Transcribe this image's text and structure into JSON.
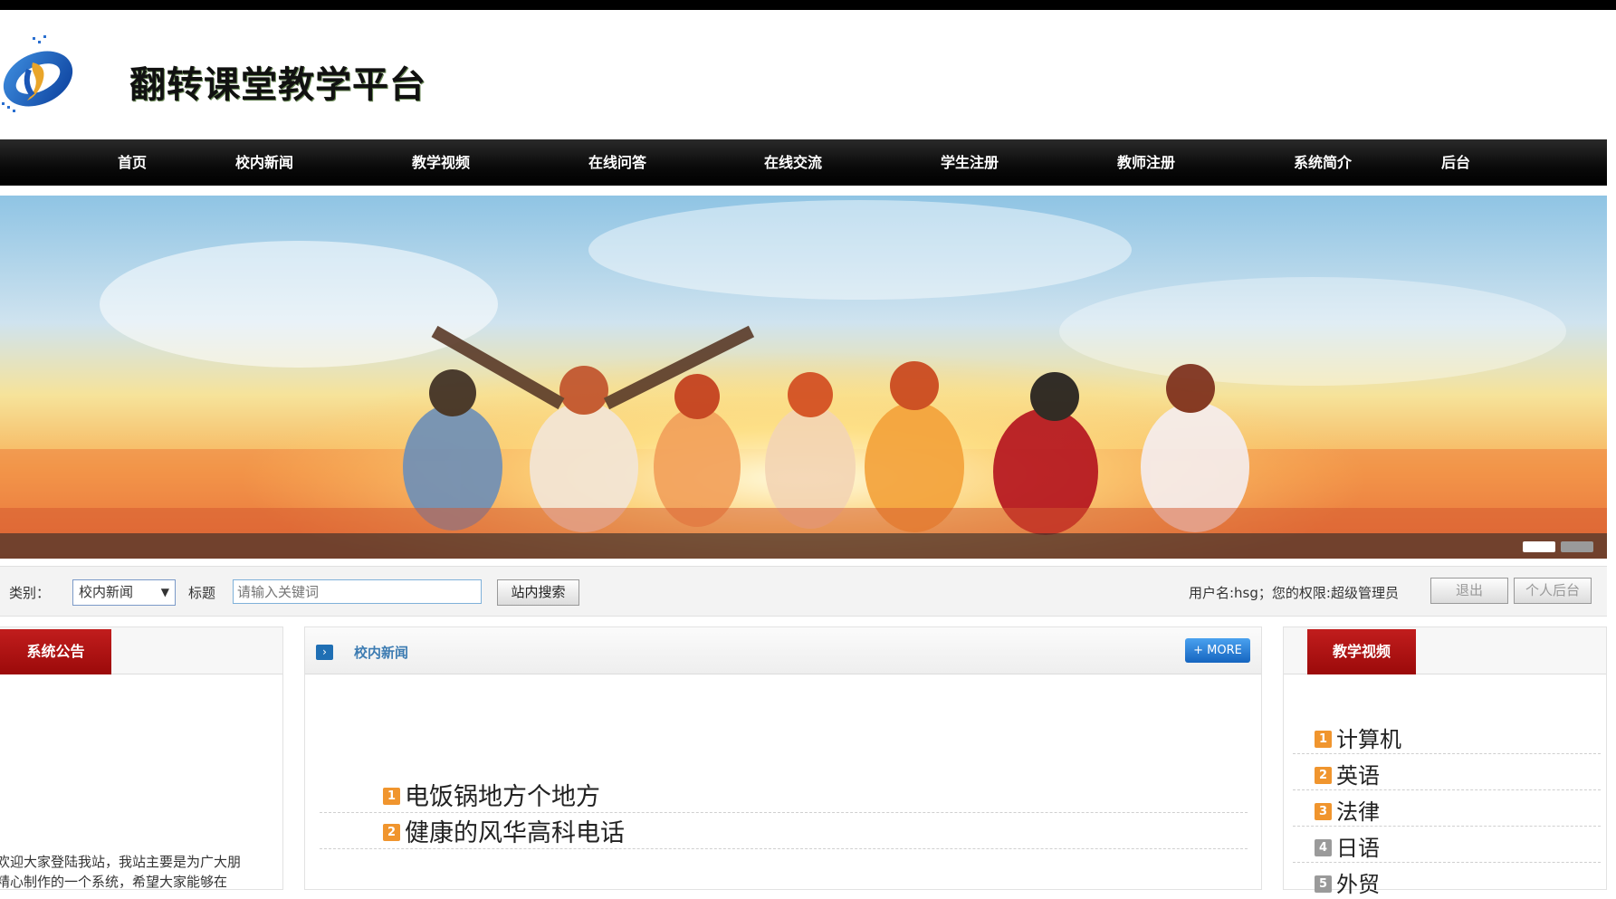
{
  "header": {
    "site_title": "翻转课堂教学平台",
    "logo_icon": "swirl-logo-icon"
  },
  "nav": {
    "items": [
      "首页",
      "校内新闻",
      "教学视频",
      "在线问答",
      "在线交流",
      "学生注册",
      "教师注册",
      "系统简介",
      "后台"
    ]
  },
  "banner": {
    "slides_total": 2,
    "active_slide": 1
  },
  "search": {
    "category_label": "类别：",
    "category_value": "校内新闻",
    "title_label": "标题",
    "keyword_placeholder": "请输入关键词",
    "search_button": "站内搜索",
    "user_info": "用户名:hsg；您的权限:超级管理员",
    "logout_button": "退出",
    "personal_button": "个人后台"
  },
  "notice": {
    "tab_label": "系统公告",
    "text_line1": "欢迎大家登陆我站，我站主要是为广大朋",
    "text_line2": "精心制作的一个系统，希望大家能够在"
  },
  "news": {
    "title": "校内新闻",
    "more_button": "+ MORE",
    "items": [
      {
        "num": "1",
        "text": "电饭锅地方个地方"
      },
      {
        "num": "2",
        "text": "健康的风华高科电话"
      }
    ]
  },
  "videos": {
    "tab_label": "教学视频",
    "items": [
      {
        "num": "1",
        "text": "计算机"
      },
      {
        "num": "2",
        "text": "英语"
      },
      {
        "num": "3",
        "text": "法律"
      },
      {
        "num": "4",
        "text": "日语"
      },
      {
        "num": "5",
        "text": "外贸"
      }
    ]
  },
  "colors": {
    "nav_bg": "#000000",
    "tab_red": "#b01414",
    "link_blue": "#3d7cb2",
    "num_orange": "#f0952e"
  }
}
